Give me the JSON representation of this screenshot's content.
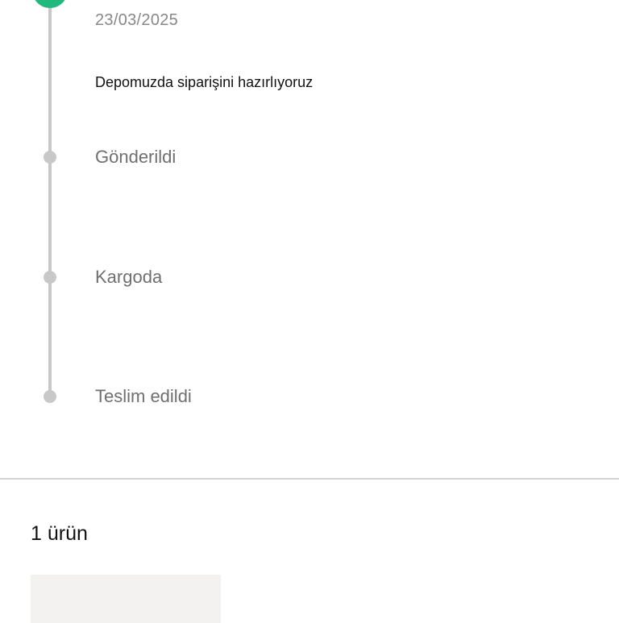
{
  "timeline": {
    "active_step": {
      "date": "23/03/2025",
      "description": "Depomuzda siparişini hazırlıyoruz",
      "status_color": "#1fb97d"
    },
    "steps": [
      {
        "label": "Gönderildi"
      },
      {
        "label": "Kargoda"
      },
      {
        "label": "Teslim edildi"
      }
    ],
    "inactive_color": "#c8c8c8"
  },
  "items": {
    "count_label": "1 ürün"
  }
}
